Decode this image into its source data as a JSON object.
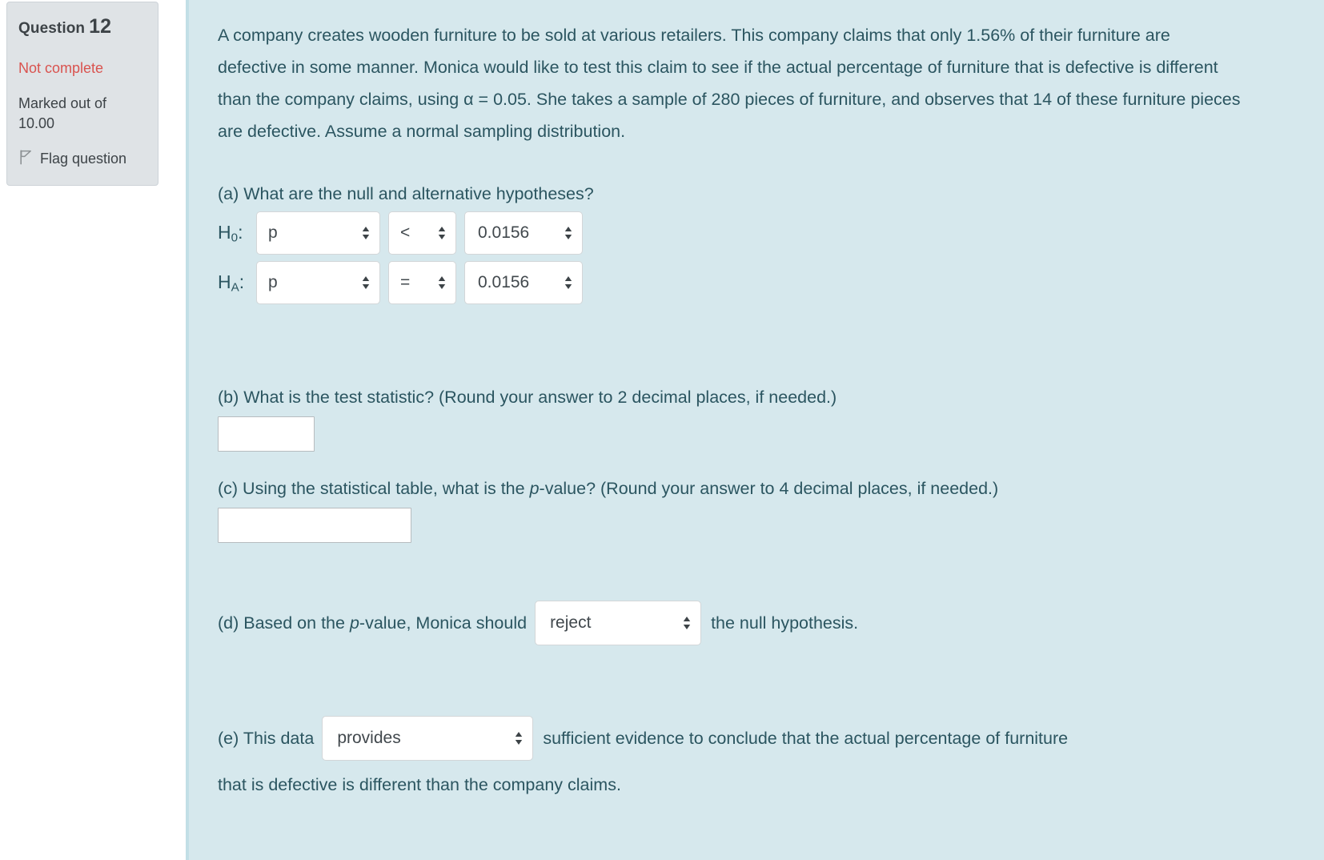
{
  "question_info": {
    "title_label": "Question",
    "number": "12",
    "status": "Not complete",
    "marks": "Marked out of 10.00",
    "flag_label": "Flag question",
    "flag_icon": "flag-icon",
    "status_color": "#d9534f",
    "panel_bg": "#dfe3e6"
  },
  "main": {
    "panel_bg": "#d6e8ed",
    "text_color": "#2b5560",
    "stem": "A company creates wooden furniture to be sold at various retailers. This company claims that only 1.56% of their furniture are defective in some manner. Monica would like to test this claim to see if the actual percentage of furniture that is defective is different than the company claims, using α = 0.05. She takes a sample of 280 pieces of furniture, and observes that 14 of these furniture pieces are defective. Assume a normal sampling distribution.",
    "part_a": {
      "prompt": "(a) What are the null and alternative hypotheses?",
      "null_label": "H",
      "null_sub": "0",
      "alt_label": "H",
      "alt_sub": "A",
      "colon": ":",
      "null_param": "p",
      "null_operator": "<",
      "null_value": "0.0156",
      "alt_param": "p",
      "alt_operator": "=",
      "alt_value": "0.0156"
    },
    "part_b": {
      "prompt": "(b) What is the test statistic? (Round your answer to 2 decimal places, if needed.)",
      "answer": "",
      "placeholder": ""
    },
    "part_c": {
      "prompt_1": "(c) Using the statistical table, what is the ",
      "prompt_italic": "p",
      "prompt_2": "-value? (Round your answer to 4 decimal places, if needed.)",
      "answer": "",
      "placeholder": ""
    },
    "part_d": {
      "text_before_1": "(d) Based on the ",
      "text_italic": "p",
      "text_before_2": "-value, Monica should",
      "decision": "reject",
      "text_after": "the null hypothesis."
    },
    "part_e": {
      "text_before": "(e) This data",
      "evidence": "provides",
      "text_after": "sufficient evidence to conclude that the actual percentage of furniture",
      "text_line2": "that is defective is different than the company claims."
    }
  }
}
